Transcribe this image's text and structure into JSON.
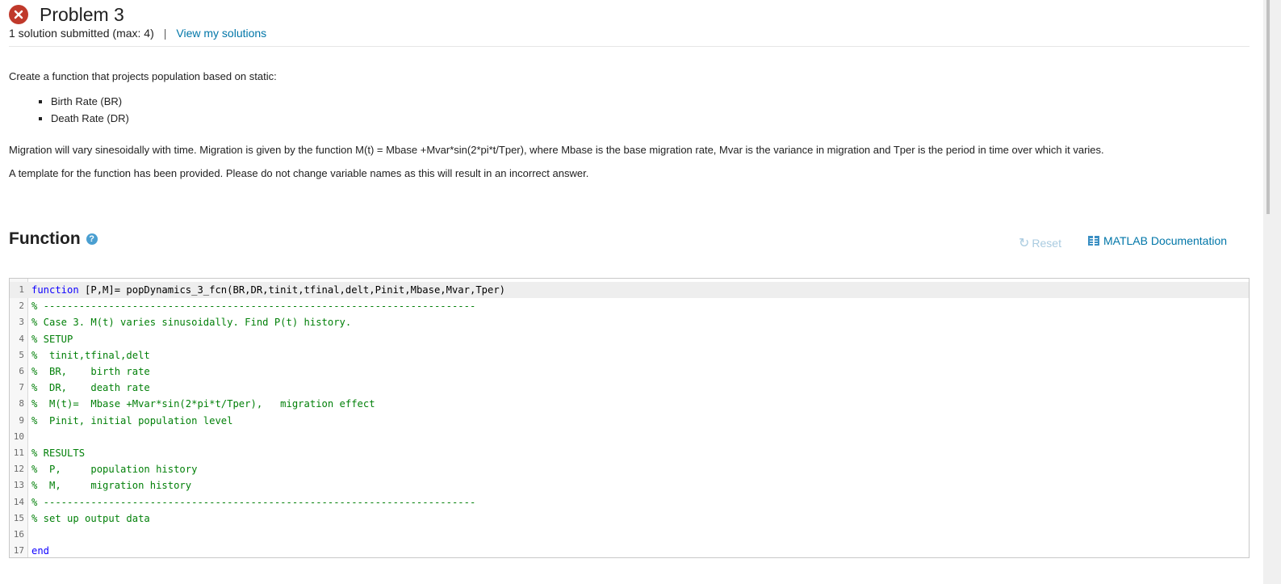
{
  "header": {
    "status_icon": "error-x-circle-icon",
    "title": "Problem 3",
    "submissions": "1 solution submitted (max: 4)",
    "separator": "|",
    "view_solutions_link": "View my solutions"
  },
  "description": {
    "intro": "Create a function that projects population based on static:",
    "bullets": [
      "Birth Rate (BR)",
      "Death Rate  (DR)"
    ],
    "migration": "Migration will vary sinesoidally with time.  Migration is given by the function M(t) = Mbase +Mvar*sin(2*pi*t/Tper), where Mbase is the base migration rate, Mvar is the variance in migration and Tper is the period in time over which it varies.",
    "template_note": "A template for the function has been provided.  Please do not change variable names as this will result in an incorrect answer."
  },
  "function_section": {
    "title": "Function",
    "help_icon": "?",
    "reset_label": "Reset",
    "reset_icon": "↻",
    "doc_label": "MATLAB Documentation"
  },
  "editor": {
    "lines": [
      {
        "n": "1",
        "kw": "function",
        "text": " [P,M]= popDynamics_3_fcn(BR,DR,tinit,tfinal,delt,Pinit,Mbase,Mvar,Tper)",
        "cm": ""
      },
      {
        "n": "2",
        "kw": "",
        "text": "",
        "cm": "% -------------------------------------------------------------------------"
      },
      {
        "n": "3",
        "kw": "",
        "text": "",
        "cm": "% Case 3. M(t) varies sinusoidally. Find P(t) history."
      },
      {
        "n": "4",
        "kw": "",
        "text": "",
        "cm": "% SETUP"
      },
      {
        "n": "5",
        "kw": "",
        "text": "",
        "cm": "%  tinit,tfinal,delt"
      },
      {
        "n": "6",
        "kw": "",
        "text": "",
        "cm": "%  BR,    birth rate"
      },
      {
        "n": "7",
        "kw": "",
        "text": "",
        "cm": "%  DR,    death rate"
      },
      {
        "n": "8",
        "kw": "",
        "text": "",
        "cm": "%  M(t)=  Mbase +Mvar*sin(2*pi*t/Tper),   migration effect"
      },
      {
        "n": "9",
        "kw": "",
        "text": "",
        "cm": "%  Pinit, initial population level"
      },
      {
        "n": "10",
        "kw": "",
        "text": "",
        "cm": ""
      },
      {
        "n": "11",
        "kw": "",
        "text": "",
        "cm": "% RESULTS"
      },
      {
        "n": "12",
        "kw": "",
        "text": "",
        "cm": "%  P,     population history"
      },
      {
        "n": "13",
        "kw": "",
        "text": "",
        "cm": "%  M,     migration history"
      },
      {
        "n": "14",
        "kw": "",
        "text": "",
        "cm": "% -------------------------------------------------------------------------"
      },
      {
        "n": "15",
        "kw": "",
        "text": "",
        "cm": "% set up output data"
      },
      {
        "n": "16",
        "kw": "",
        "text": "",
        "cm": ""
      },
      {
        "n": "17",
        "kw": "end",
        "text": "",
        "cm": ""
      }
    ]
  }
}
